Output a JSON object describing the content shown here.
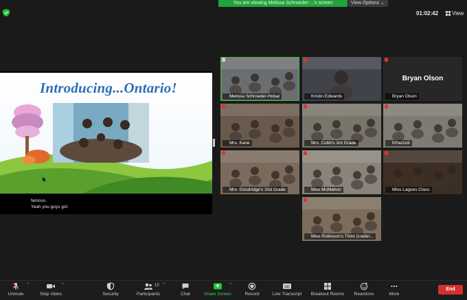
{
  "topbar": {
    "share_banner": "You are viewing Melissa Schroeder-...'s screen",
    "view_options": "View Options ⌄",
    "timer": "01:02:42",
    "view_label": "View"
  },
  "shared_screen": {
    "slide_title": "Introducing...Ontario!",
    "captions": [
      "famous.",
      "Yeah you guys got"
    ]
  },
  "participants": [
    {
      "name": "Melissa Schroeder-Hribal",
      "active": true,
      "bg": "#6b6e70"
    },
    {
      "name": "Kristin Edwards",
      "active": false,
      "bg": "#41434a"
    },
    {
      "name": "Bryan Olson",
      "active": false,
      "bg": "#272727",
      "big_name": "Bryan Olson"
    },
    {
      "name": "Mrs. Kane",
      "active": false,
      "bg": "#6a5a4c"
    },
    {
      "name": "Mrs. Cobb's 3rd Grade",
      "active": false,
      "bg": "#7a756a"
    },
    {
      "name": "KPazzuti",
      "active": false,
      "bg": "#7e7a74"
    },
    {
      "name": "Mrs. Goodridge's 2nd Grade",
      "active": false,
      "bg": "#7a6c5c"
    },
    {
      "name": "Miss McMahon",
      "active": false,
      "bg": "#8a8379"
    },
    {
      "name": "Miss Lagoes Class",
      "active": false,
      "bg": "#3d2e24"
    },
    {
      "name": "Miss Robinson's Third Grader...",
      "active": false,
      "bg": "#7c6e5c"
    }
  ],
  "toolbar": {
    "unmute": "Unmute",
    "stop_video": "Stop Video",
    "security": "Security",
    "participants": "Participants",
    "participants_count": "10",
    "chat": "Chat",
    "share_screen": "Share Screen",
    "record": "Record",
    "live_transcript": "Live Transcript",
    "breakout_rooms": "Breakout Rooms",
    "reactions": "Reactions",
    "more": "More",
    "end": "End"
  },
  "colors": {
    "accent_green": "#23a33b",
    "end_red": "#d62f2f",
    "active_outline": "#3fbf3f"
  }
}
